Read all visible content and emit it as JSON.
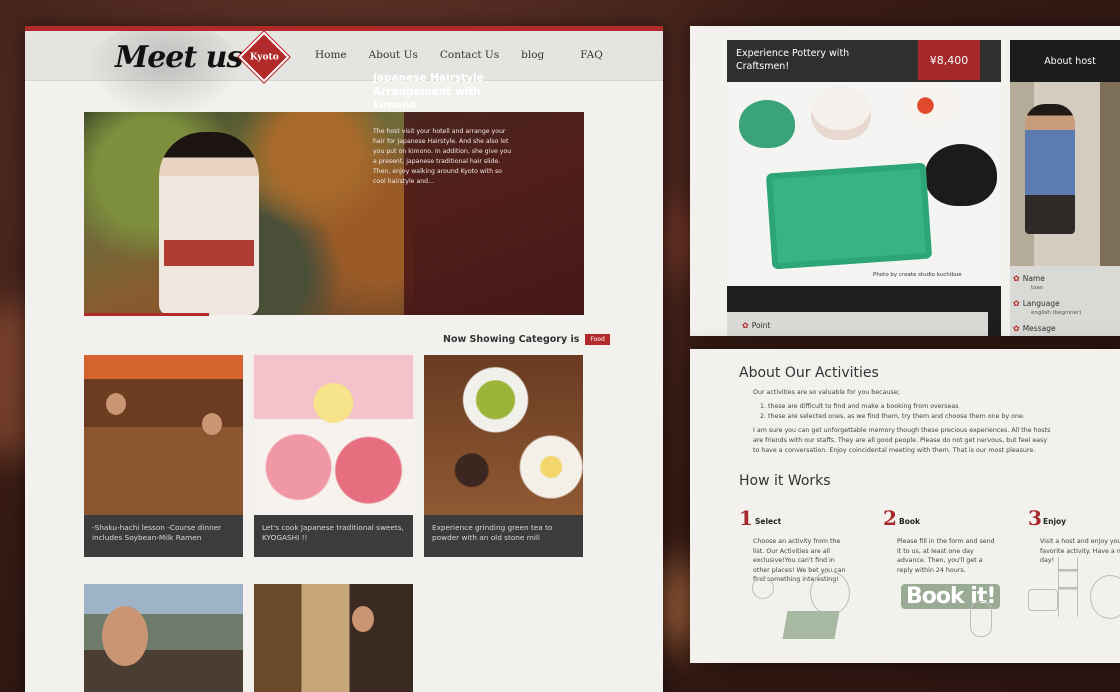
{
  "site": {
    "logo_text": "Meet us",
    "logo_badge": "Kyoto",
    "nav": [
      "Home",
      "About Us",
      "Contact Us",
      "blog",
      "FAQ"
    ]
  },
  "hero": {
    "title": "Japanese Hairstyle Arrangement with kimono",
    "description": "The host visit your hotell and arrange your hair for Japanese Hairstyle. And she also let you put on kimono. In addition, she give you a present, japanese traditional hair slide. Then, enjoy walking around Kyoto with so cool hairstyle and..."
  },
  "category": {
    "label": "Now Showing Category is",
    "badge": "Food"
  },
  "cards": [
    {
      "caption": "-Shaku-hachi lesson -Course dinner includes Soybean-Milk Ramen"
    },
    {
      "caption": "Let's cook  Japanese traditional sweets, KYOGASHI !!"
    },
    {
      "caption": "Experience grinding green tea to powder with an old stone mill"
    }
  ],
  "activity": {
    "title": "Experience Pottery with Craftsmen!",
    "price": "¥8,400",
    "photo_credit": "Photo by create studio kuchibue",
    "point_label": "Point"
  },
  "host": {
    "heading": "About host",
    "name_label": "Name",
    "name_value": "toan",
    "language_label": "Language",
    "language_value": "english (beginner)",
    "message_label": "Message"
  },
  "about": {
    "heading": "About Our Activities",
    "intro": "Our activities are so valuable for you because;",
    "reasons": [
      "these are difficult to find and make a booking from overseas",
      "these are selected ones, as we find them, try them and choose them one by one."
    ],
    "paragraph": "I am sure you can get unforgettable memory though these precious experiences. All the hosts are friends with our staffs. They are all good people. Please do not get nervous, but feel easy to have a conversation. Enjoy coincidental meeting with them. That is our most pleasure."
  },
  "how": {
    "heading": "How it Works",
    "steps": [
      {
        "num": "1",
        "label": "Select",
        "desc": "Choose an activity from the list. Our Activities are all exclusive!You can't find in other places! We bet you can find something interesting!"
      },
      {
        "num": "2",
        "label": "Book",
        "desc": "Please fill in the form and send it to us, at least one day advance. Then, you'll get a reply within 24 hours."
      },
      {
        "num": "3",
        "label": "Enjoy",
        "desc": "Visit a host and enjoy your favorite activity. Have a nice day!"
      }
    ],
    "book_it": "Book it!"
  },
  "colors": {
    "accent": "#b32a2a",
    "caption_bg": "#3c3c3c"
  }
}
